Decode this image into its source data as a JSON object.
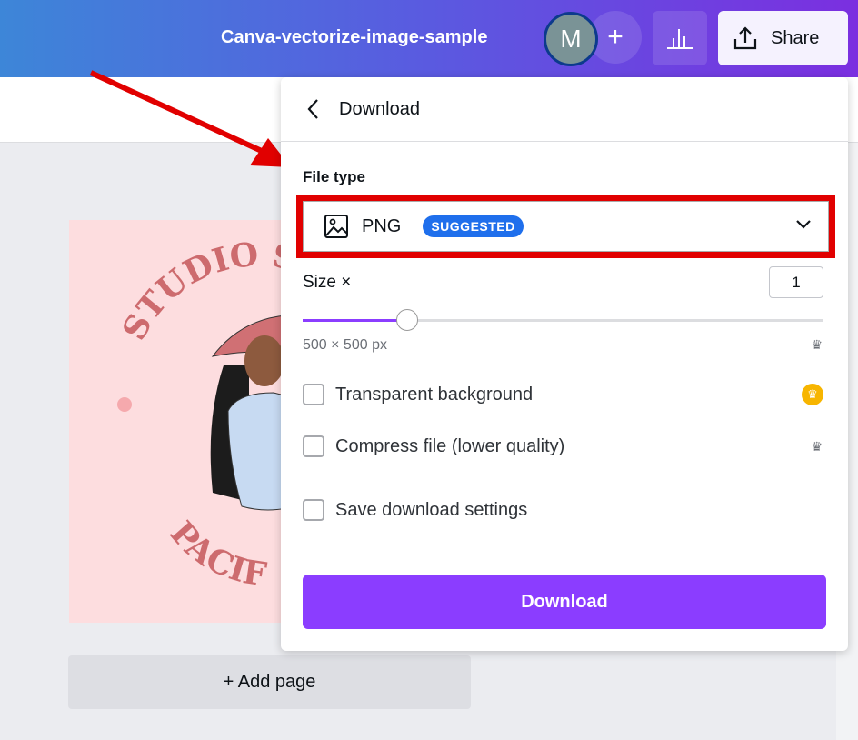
{
  "header": {
    "title": "Canva-vectorize-image-sample",
    "avatar_initial": "M",
    "add_label": "+",
    "share_label": "Share"
  },
  "design": {
    "top_text": "STUDIO S",
    "bottom_text": "PACIF"
  },
  "canvas": {
    "add_page_label": "+ Add page"
  },
  "download_panel": {
    "title": "Download",
    "file_type_label": "File type",
    "file_type_value": "PNG",
    "file_type_badge": "SUGGESTED",
    "size_label": "Size ×",
    "size_value": "1",
    "size_slider_fraction": 0.2,
    "dimensions": "500 × 500 px",
    "options": [
      {
        "label": "Transparent background",
        "checked": false
      },
      {
        "label": "Compress file (lower quality)",
        "checked": false
      },
      {
        "label": "Save download settings",
        "checked": false
      }
    ],
    "download_button": "Download"
  },
  "colors": {
    "accent": "#8b3dff",
    "highlight": "#e10000",
    "badge": "#1f6fec"
  }
}
